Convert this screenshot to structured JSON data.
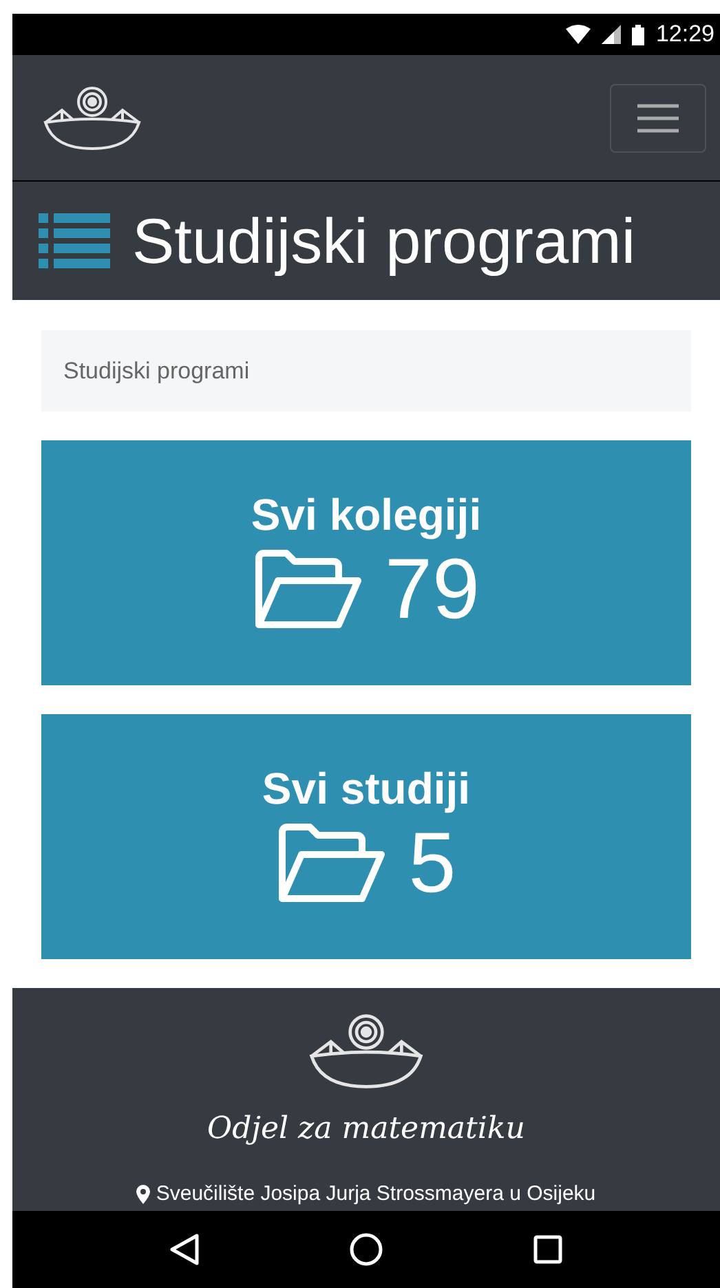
{
  "status_bar": {
    "time": "12:29"
  },
  "page_header": {
    "title": "Studijski programi"
  },
  "breadcrumb": {
    "items": [
      "Studijski programi"
    ]
  },
  "cards": [
    {
      "title": "Svi kolegiji",
      "count": "79"
    },
    {
      "title": "Svi studiji",
      "count": "5"
    }
  ],
  "footer": {
    "department": "Odjel za matematiku",
    "address": "Sveučilište Josipa Jurja Strossmayera u Osijeku"
  }
}
